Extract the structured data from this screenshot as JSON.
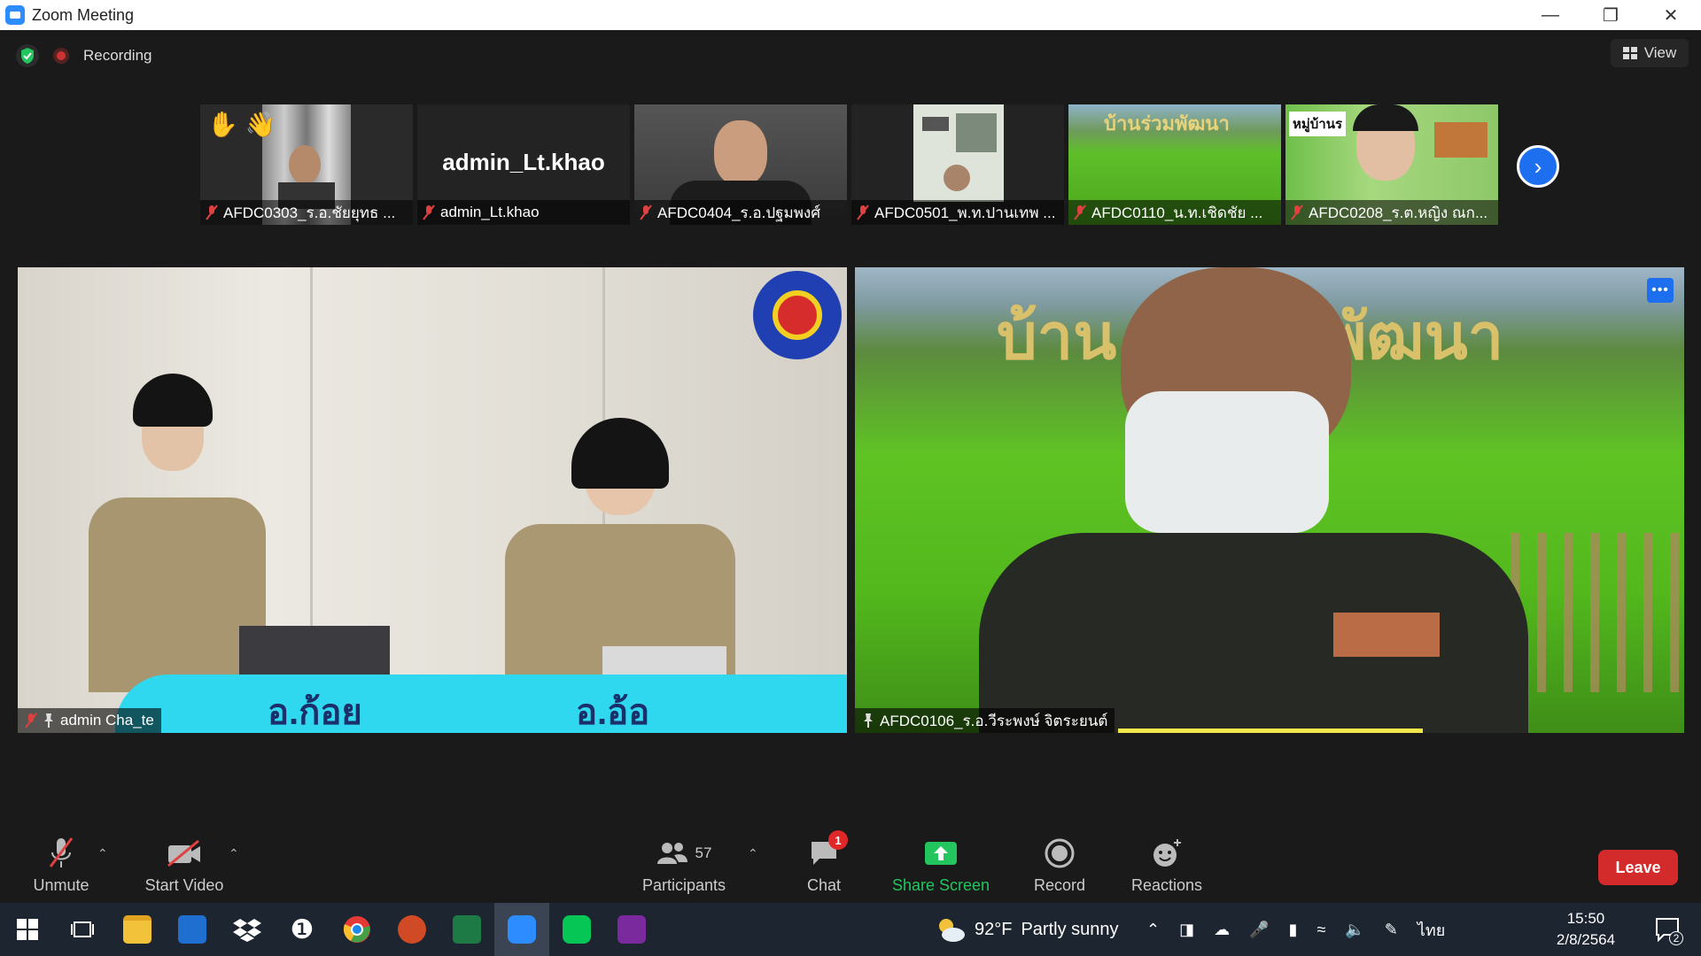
{
  "window": {
    "title": "Zoom Meeting"
  },
  "top_bar": {
    "recording_label": "Recording",
    "view_label": "View"
  },
  "thumbnails": [
    {
      "name": "AFDC0303_ร.อ.ชัยยุทธ  ...",
      "reactions": "✋ 👋"
    },
    {
      "name": "admin_Lt.khao",
      "display_name": "admin_Lt.khao"
    },
    {
      "name": "AFDC0404_ร.อ.ปฐมพงศ์"
    },
    {
      "name": "AFDC0501_พ.ท.ปานเทพ ..."
    },
    {
      "name": "AFDC0110_น.ท.เชิดชัย  ...",
      "banner": "บ้านร่วมพัฒนา"
    },
    {
      "name": "AFDC0208_ร.ต.หญิง ณก...",
      "banner": "หมู่บ้านร"
    }
  ],
  "tiles": {
    "left": {
      "name": "admin Cha_te",
      "caption_left": "อ.ก้อย",
      "caption_right": "อ.อ้อ"
    },
    "right": {
      "name": "AFDC0106_ร.อ.วีระพงษ์ จิตระยนต์",
      "banner_left": "บ้าน",
      "banner_right": "พัฒนา"
    }
  },
  "toolbar": {
    "unmute": "Unmute",
    "start_video": "Start Video",
    "participants": "Participants",
    "participants_count": "57",
    "chat": "Chat",
    "chat_badge": "1",
    "share_screen": "Share Screen",
    "record": "Record",
    "reactions": "Reactions",
    "leave": "Leave"
  },
  "taskbar": {
    "temperature": "92°F",
    "weather": "Partly sunny",
    "language": "ไทย",
    "time": "15:50",
    "date": "2/8/2564",
    "notification_count": "2"
  },
  "colors": {
    "accent": "#2d8cff",
    "leave": "#d32b2b",
    "share": "#22c55e",
    "speaker": "#f2e74a"
  }
}
